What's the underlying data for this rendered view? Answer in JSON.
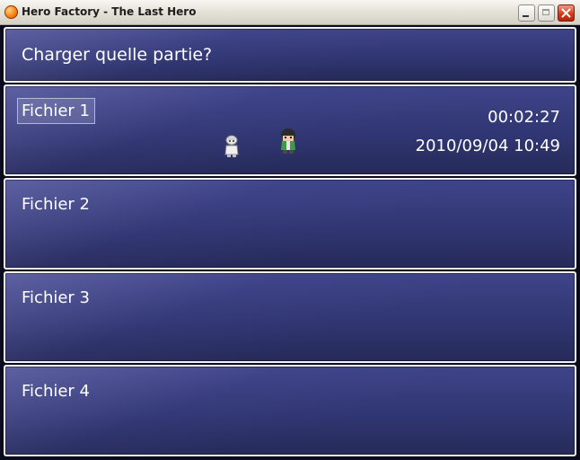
{
  "window": {
    "title": "Hero Factory - The Last Hero",
    "icon": "app-orb-icon"
  },
  "header": {
    "prompt": "Charger quelle partie?"
  },
  "slots": [
    {
      "label": "Fichier 1",
      "selected": true,
      "playtime": "00:02:27",
      "saved_at": "2010/09/04 10:49",
      "party": [
        "white-robed-character-sprite",
        "dark-haired-hero-sprite"
      ]
    },
    {
      "label": "Fichier 2",
      "selected": false
    },
    {
      "label": "Fichier 3",
      "selected": false
    },
    {
      "label": "Fichier 4",
      "selected": false
    }
  ],
  "colors": {
    "panel_top": "#3e4488",
    "panel_bottom": "#262a58",
    "panel_border": "#f2f2f2",
    "text": "#ffffff"
  }
}
